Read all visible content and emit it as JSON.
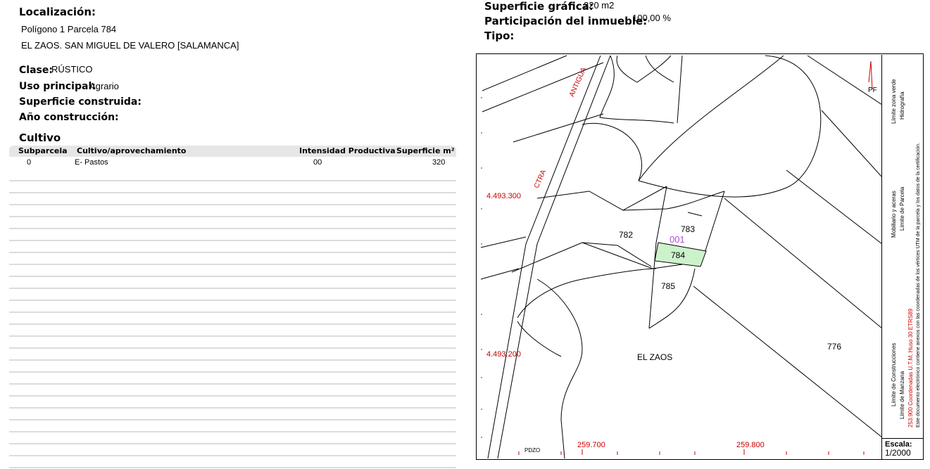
{
  "localizacion": {
    "label": "Localización:",
    "line1": "Polígono 1 Parcela 784",
    "line2": "EL ZAOS. SAN MIGUEL DE VALERO [SALAMANCA]"
  },
  "clase": {
    "label": "Clase:",
    "value": "RÚSTICO"
  },
  "uso": {
    "label": "Uso principal:",
    "value": "Agrario"
  },
  "sup_construida": {
    "label": "Superficie construida:",
    "value": ""
  },
  "anio": {
    "label": "Año construcción:",
    "value": ""
  },
  "sup_grafica": {
    "label": "Superficie gráfica:",
    "value": "320 m2"
  },
  "participacion": {
    "label": "Participación del inmueble:",
    "value": "100,00 %"
  },
  "tipo": {
    "label": "Tipo:",
    "value": ""
  },
  "cultivo": {
    "title": "Cultivo",
    "headers": [
      "Subparcela",
      "Cultivo/aprovechamiento",
      "Intensidad Productiva",
      "Superficie m²"
    ],
    "rows": [
      [
        "0",
        "E- Pastos",
        "00",
        "320"
      ]
    ]
  },
  "map": {
    "parcels": [
      "782",
      "783",
      "784",
      "785",
      "776"
    ],
    "highlight": "001",
    "place": "EL ZAOS",
    "road_labels": [
      "ANTIGUA",
      "CTRA"
    ],
    "coord_y": [
      "4.493.300",
      "4.493.200"
    ],
    "coord_x": [
      "259.700",
      "259.800"
    ],
    "north_label": "PF",
    "bottom_label": "PDZO",
    "highlight_color": "#ccf2cc",
    "legend": {
      "col1": [
        "Límite de Manzana",
        "Límite de Parcela",
        "Hidrografía"
      ],
      "col2": [
        "Límite de Construcciones",
        "Mobiliario y aceras",
        "Límite zona verde"
      ],
      "red": "253.900 Coordenadas U.T.M. Huso 30 ETRS89",
      "col4": "Este documento electrónico contiene anexos con las coordenadas de los vértices UTM de la parcela y los datos de la certificación."
    },
    "scale_label": "Escala:",
    "scale_value": "1/2000"
  }
}
